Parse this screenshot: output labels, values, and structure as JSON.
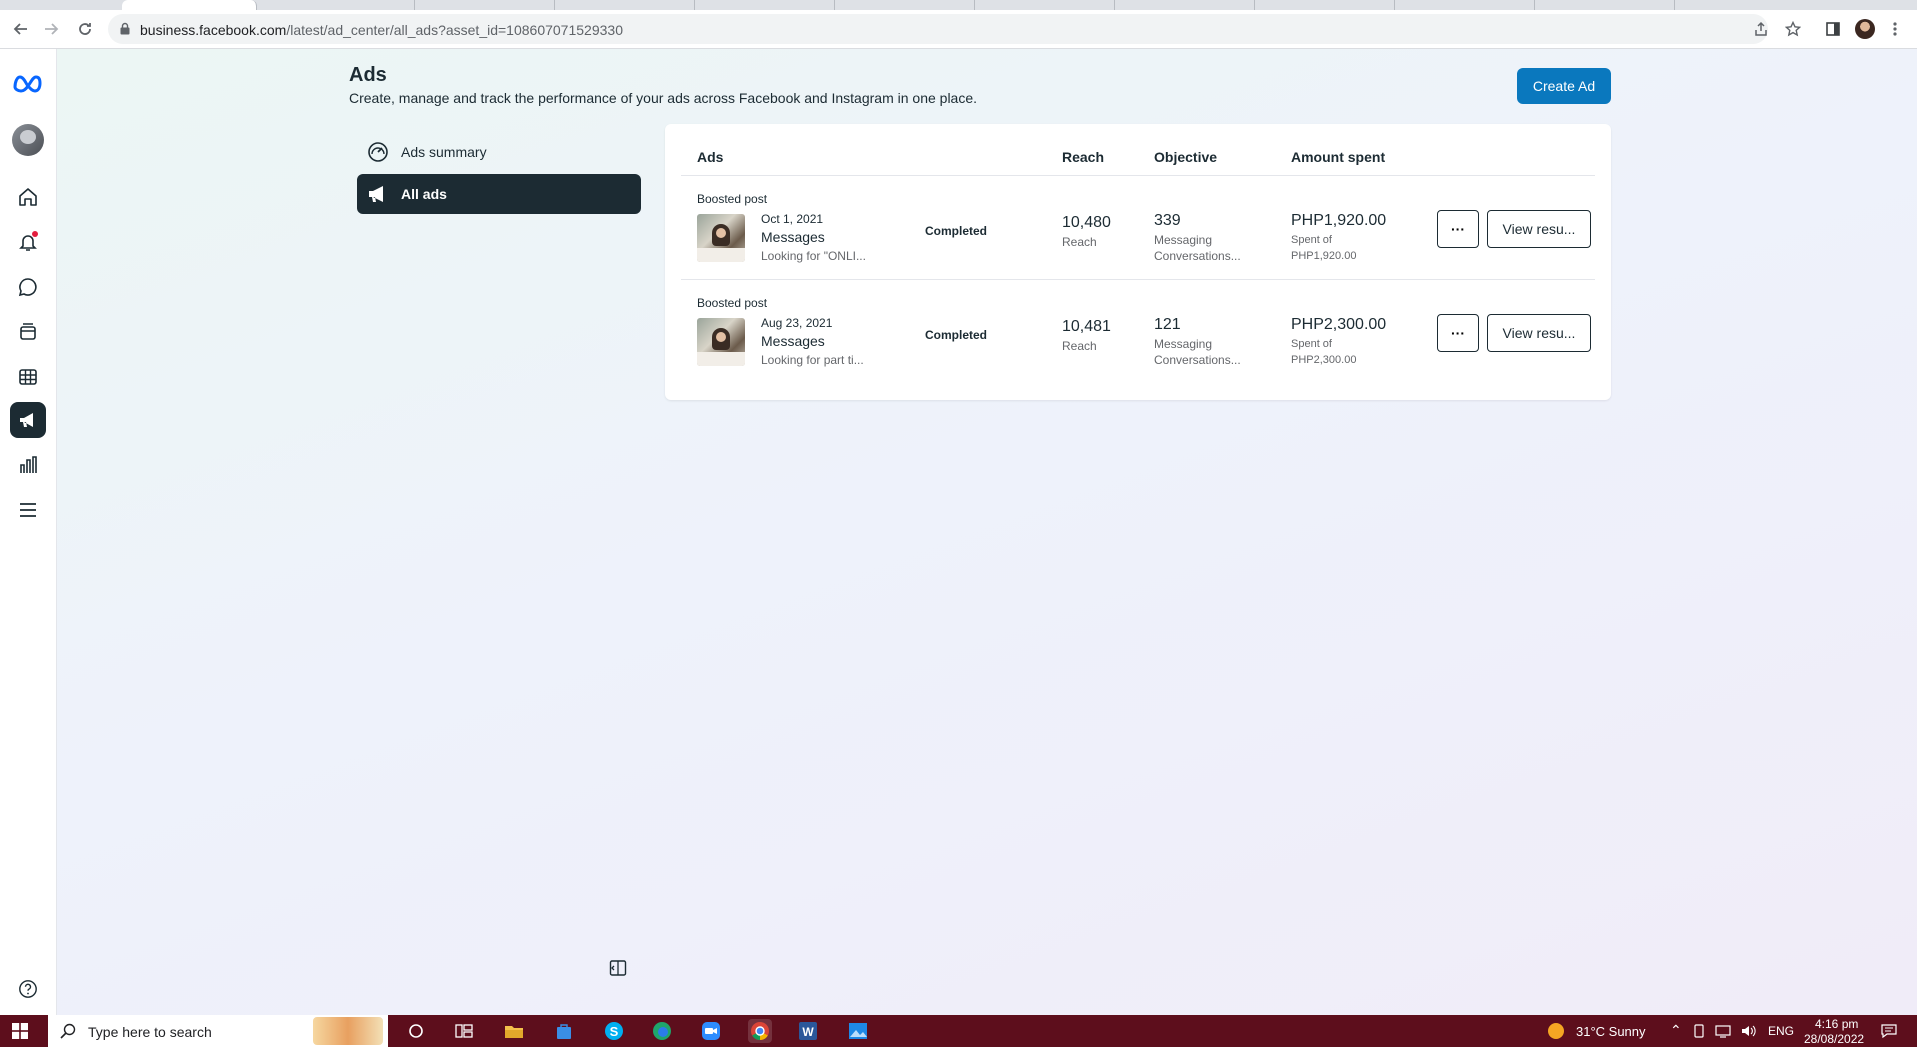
{
  "browser": {
    "url_host": "business.facebook.com",
    "url_path": "/latest/ad_center/all_ads?asset_id=108607071529330"
  },
  "page": {
    "title": "Ads",
    "subtitle": "Create, manage and track the performance of your ads across Facebook and Instagram in one place.",
    "create_button": "Create Ad"
  },
  "sidebar": {
    "items": [
      {
        "label": "Ads summary",
        "icon": "gauge-icon"
      },
      {
        "label": "All ads",
        "icon": "megaphone-icon"
      }
    ]
  },
  "table": {
    "headers": {
      "ads": "Ads",
      "reach": "Reach",
      "objective": "Objective",
      "amount": "Amount spent"
    },
    "rows": [
      {
        "kind": "Boosted post",
        "date": "Oct 1, 2021",
        "objective": "Messages",
        "snippet": "Looking for \"ONLI...",
        "status": "Completed",
        "reach_value": "10,480",
        "reach_label": "Reach",
        "result_value": "339",
        "result_label": "Messaging Conversations...",
        "amount_value": "PHP1,920.00",
        "amount_label": "Spent of PHP1,920.00",
        "more": "···",
        "view": "View resu..."
      },
      {
        "kind": "Boosted post",
        "date": "Aug 23, 2021",
        "objective": "Messages",
        "snippet": "Looking for part ti...",
        "status": "Completed",
        "reach_value": "10,481",
        "reach_label": "Reach",
        "result_value": "121",
        "result_label": "Messaging Conversations...",
        "amount_value": "PHP2,300.00",
        "amount_label": "Spent of PHP2,300.00",
        "more": "···",
        "view": "View resu..."
      }
    ]
  },
  "taskbar": {
    "search_placeholder": "Type here to search",
    "weather": "31°C  Sunny",
    "language": "ENG",
    "time": "4:16 pm",
    "date": "28/08/2022"
  },
  "colors": {
    "brand_blue": "#0a78be",
    "dark_navy": "#1c2b33",
    "taskbar": "#5d0e1c"
  }
}
